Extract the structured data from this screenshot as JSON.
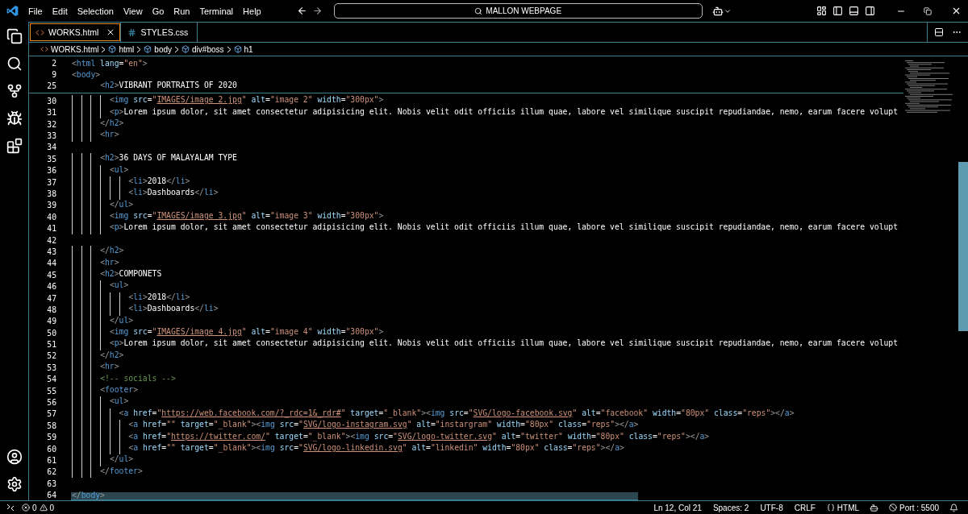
{
  "menu": [
    "File",
    "Edit",
    "Selection",
    "View",
    "Go",
    "Run",
    "Terminal",
    "Help"
  ],
  "command_center": {
    "value": "MALLON WEBPAGE"
  },
  "tabs": [
    {
      "label": "WORKS.html",
      "kind": "html",
      "selected": true
    },
    {
      "label": "STYLES.css",
      "kind": "css",
      "selected": false
    }
  ],
  "breadcrumbs": [
    {
      "label": "WORKS.html",
      "kind": "file"
    },
    {
      "label": "html",
      "kind": "element"
    },
    {
      "label": "body",
      "kind": "element"
    },
    {
      "label": "div#boss",
      "kind": "element"
    },
    {
      "label": "h1",
      "kind": "element"
    }
  ],
  "sticky_lines": [
    {
      "number": "2",
      "code": "<html lang=\"en\">"
    },
    {
      "number": "9",
      "code": "<body>"
    },
    {
      "number": "25",
      "code": "      <h2>VIBRANT PORTRAITS OF 2020"
    }
  ],
  "lines": [
    {
      "number": "30",
      "code": "        <img src=\"IMAGES/image 2.jpg\" alt=\"image 2\" width=\"300px\">"
    },
    {
      "number": "31",
      "code": "        <p>Lorem ipsum dolor, sit amet consectetur adipisicing elit. Nobis velit odit officiis illum quae, labore vel similique suscipit repudiandae, nemo, earum facere volupt"
    },
    {
      "number": "32",
      "code": "      </h2>"
    },
    {
      "number": "33",
      "code": "      <hr>"
    },
    {
      "number": "34"
    },
    {
      "number": "35",
      "code": "      <h2>36 DAYS OF MALAYALAM TYPE"
    },
    {
      "number": "36",
      "code": "        <ul>"
    },
    {
      "number": "37",
      "code": "            <li>2018</li>"
    },
    {
      "number": "38",
      "code": "            <li>Dashboards</li>"
    },
    {
      "number": "39",
      "code": "        </ul>"
    },
    {
      "number": "40",
      "code": "        <img src=\"IMAGES/image 3.jpg\" alt=\"image 3\" width=\"300px\">"
    },
    {
      "number": "41",
      "code": "        <p>Lorem ipsum dolor, sit amet consectetur adipisicing elit. Nobis velit odit officiis illum quae, labore vel similique suscipit repudiandae, nemo, earum facere volupt"
    },
    {
      "number": "42"
    },
    {
      "number": "43",
      "code": "      </h2>"
    },
    {
      "number": "44",
      "code": "      <hr>"
    },
    {
      "number": "45",
      "code": "      <h2>COMPONETS"
    },
    {
      "number": "46",
      "code": "        <ul>"
    },
    {
      "number": "47",
      "code": "            <li>2018</li>"
    },
    {
      "number": "48",
      "code": "            <li>Dashboards</li>"
    },
    {
      "number": "49",
      "code": "        </ul>"
    },
    {
      "number": "50",
      "code": "        <img src=\"IMAGES/image 4.jpg\" alt=\"image 4\" width=\"300px\">"
    },
    {
      "number": "51",
      "code": "        <p>Lorem ipsum dolor, sit amet consectetur adipisicing elit. Nobis velit odit officiis illum quae, labore vel similique suscipit repudiandae, nemo, earum facere volupt"
    },
    {
      "number": "52",
      "code": "      </h2>"
    },
    {
      "number": "53",
      "code": "      <hr>"
    },
    {
      "number": "54",
      "code": "      <!-- socials -->"
    },
    {
      "number": "55",
      "code": "      <footer>"
    },
    {
      "number": "56",
      "code": "        <ul>"
    },
    {
      "number": "57",
      "code": "          <a href=\"https://web.facebook.com/?_rdc=1&_rdr#\" target=\"_blank\"><img src=\"SVG/logo-facebook.svg\" alt=\"facebook\" width=\"80px\" class=\"reps\"></a>"
    },
    {
      "number": "58",
      "code": "            <a href=\"\" target=\"_blank\"><img src=\"SVG/logo-instagram.svg\" alt=\"instargram\" width=\"80px\" class=\"reps\"></a>"
    },
    {
      "number": "59",
      "code": "            <a href=\"https://twitter.com/\" target=\"_blank\"><img src=\"SVG/logo-twitter.svg\" alt=\"twitter\" width=\"80px\" class=\"reps\"></a>"
    },
    {
      "number": "60",
      "code": "            <a href=\"\" target=\"_blank\"><img src=\"SVG/logo-linkedin.svg\" alt=\"linkedin\" width=\"80px\" class=\"reps\"></a>"
    },
    {
      "number": "61",
      "code": "        </ul>"
    },
    {
      "number": "62",
      "code": "      </footer>"
    },
    {
      "number": "63"
    },
    {
      "number": "64",
      "code": "</body>"
    }
  ],
  "status_bar": {
    "errors": "0",
    "warnings": "0",
    "position": "Ln 12, Col 21",
    "spaces": "Spaces: 2",
    "encoding": "UTF-8",
    "eol": "CRLF",
    "language": "HTML",
    "port": "Port : 5500"
  }
}
